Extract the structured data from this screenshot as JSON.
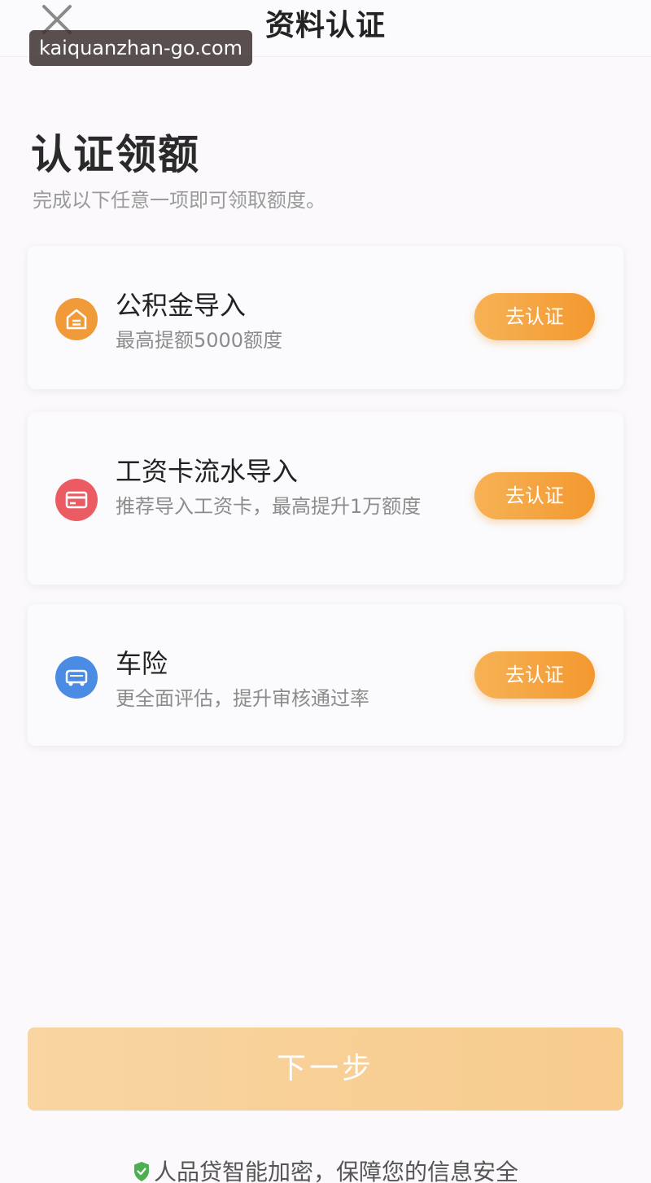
{
  "header": {
    "title": "资料认证",
    "close_icon": "close-icon"
  },
  "watermark": {
    "text": "kaiquanzhan-go.com"
  },
  "intro": {
    "heading": "认证领额",
    "subheading": "完成以下任意一项即可领取额度。"
  },
  "cards": [
    {
      "title": "公积金导入",
      "desc": "最高提额5000额度",
      "button": "去认证",
      "icon": "house-icon",
      "color": "#f19a3a"
    },
    {
      "title": "工资卡流水导入",
      "desc": "推荐导入工资卡，最高提升1万额度",
      "button": "去认证",
      "icon": "card-icon",
      "color": "#ea5c62"
    },
    {
      "title": "车险",
      "desc": "更全面评估，提升审核通过率",
      "button": "去认证",
      "icon": "car-icon",
      "color": "#4a8be3"
    }
  ],
  "next_button": {
    "label": "下一步"
  },
  "footer": {
    "text": "人品贷智能加密，保障您的信息安全",
    "icon": "shield-check-icon"
  },
  "colors": {
    "accent": "#f3982f",
    "background": "#fbf9fc"
  }
}
